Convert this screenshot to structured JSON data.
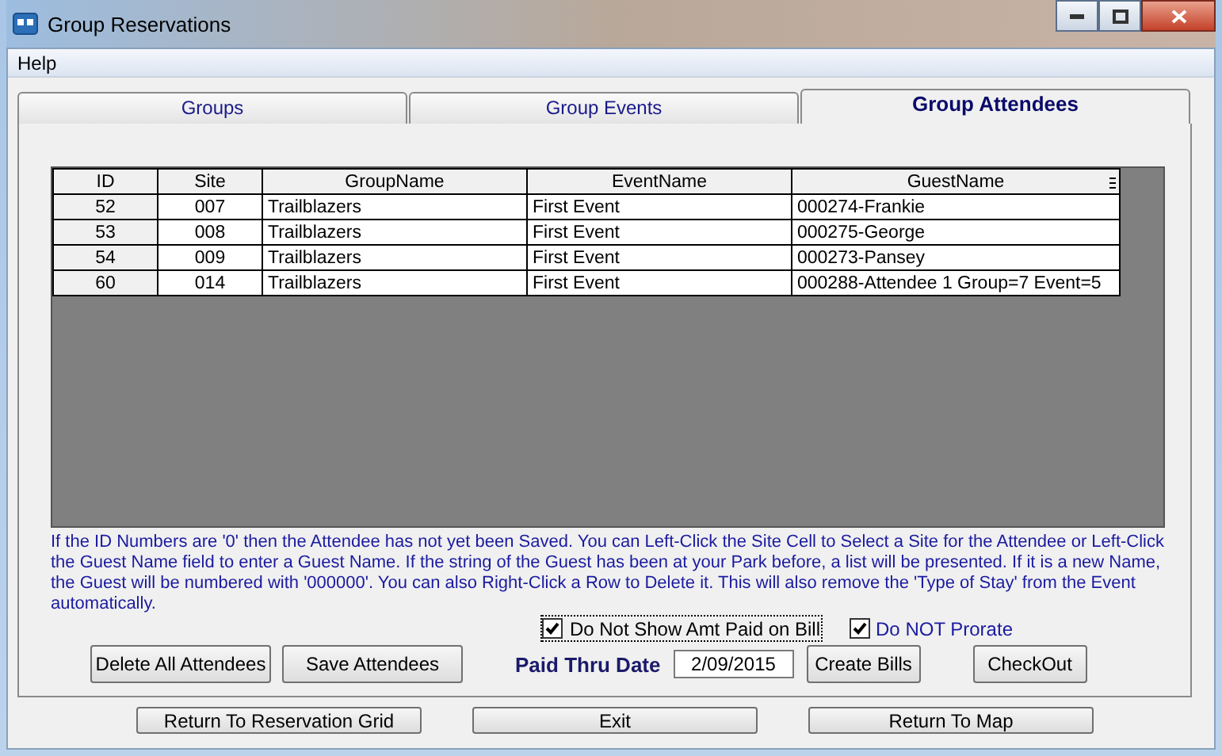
{
  "window": {
    "title": "Group Reservations"
  },
  "menu": [
    "Help"
  ],
  "tabs": [
    {
      "label": "Groups",
      "selected": false
    },
    {
      "label": "Group Events",
      "selected": false
    },
    {
      "label": "Group Attendees",
      "selected": true
    }
  ],
  "table": {
    "columns": [
      "ID",
      "Site",
      "GroupName",
      "EventName",
      "GuestName"
    ],
    "rows": [
      [
        "52",
        "007",
        "Trailblazers",
        "First Event",
        "000274-Frankie"
      ],
      [
        "53",
        "008",
        "Trailblazers",
        "First Event",
        "000275-George"
      ],
      [
        "54",
        "009",
        "Trailblazers",
        "First Event",
        "000273-Pansey"
      ],
      [
        "60",
        "014",
        "Trailblazers",
        "First Event",
        "000288-Attendee 1 Group=7 Event=5"
      ]
    ]
  },
  "instructions": "If the ID Numbers are '0' then the Attendee has not yet been Saved. You can Left-Click the Site Cell to Select a Site for the Attendee or Left-Click the Guest Name field to enter a Guest Name.  If the string of the Guest has been at your Park before, a list will be presented.  If it is a new Name, the Guest will be numbered with '000000'.  You can also Right-Click a Row to Delete it.  This will also remove the 'Type of Stay' from the Event automatically.",
  "options": [
    {
      "label": "Do Not Show Amt Paid on Bill",
      "checked": true
    },
    {
      "label": "Do NOT Prorate",
      "checked": true
    }
  ],
  "actions": [
    "Delete All Attendees",
    "Save Attendees"
  ],
  "paid_thru": {
    "label": "Paid Thru Date",
    "value": "2/09/2015"
  },
  "bill_actions": [
    "Create Bills",
    "CheckOut"
  ],
  "footer_buttons": [
    "Return To Reservation Grid",
    "Exit",
    "Return To Map"
  ]
}
